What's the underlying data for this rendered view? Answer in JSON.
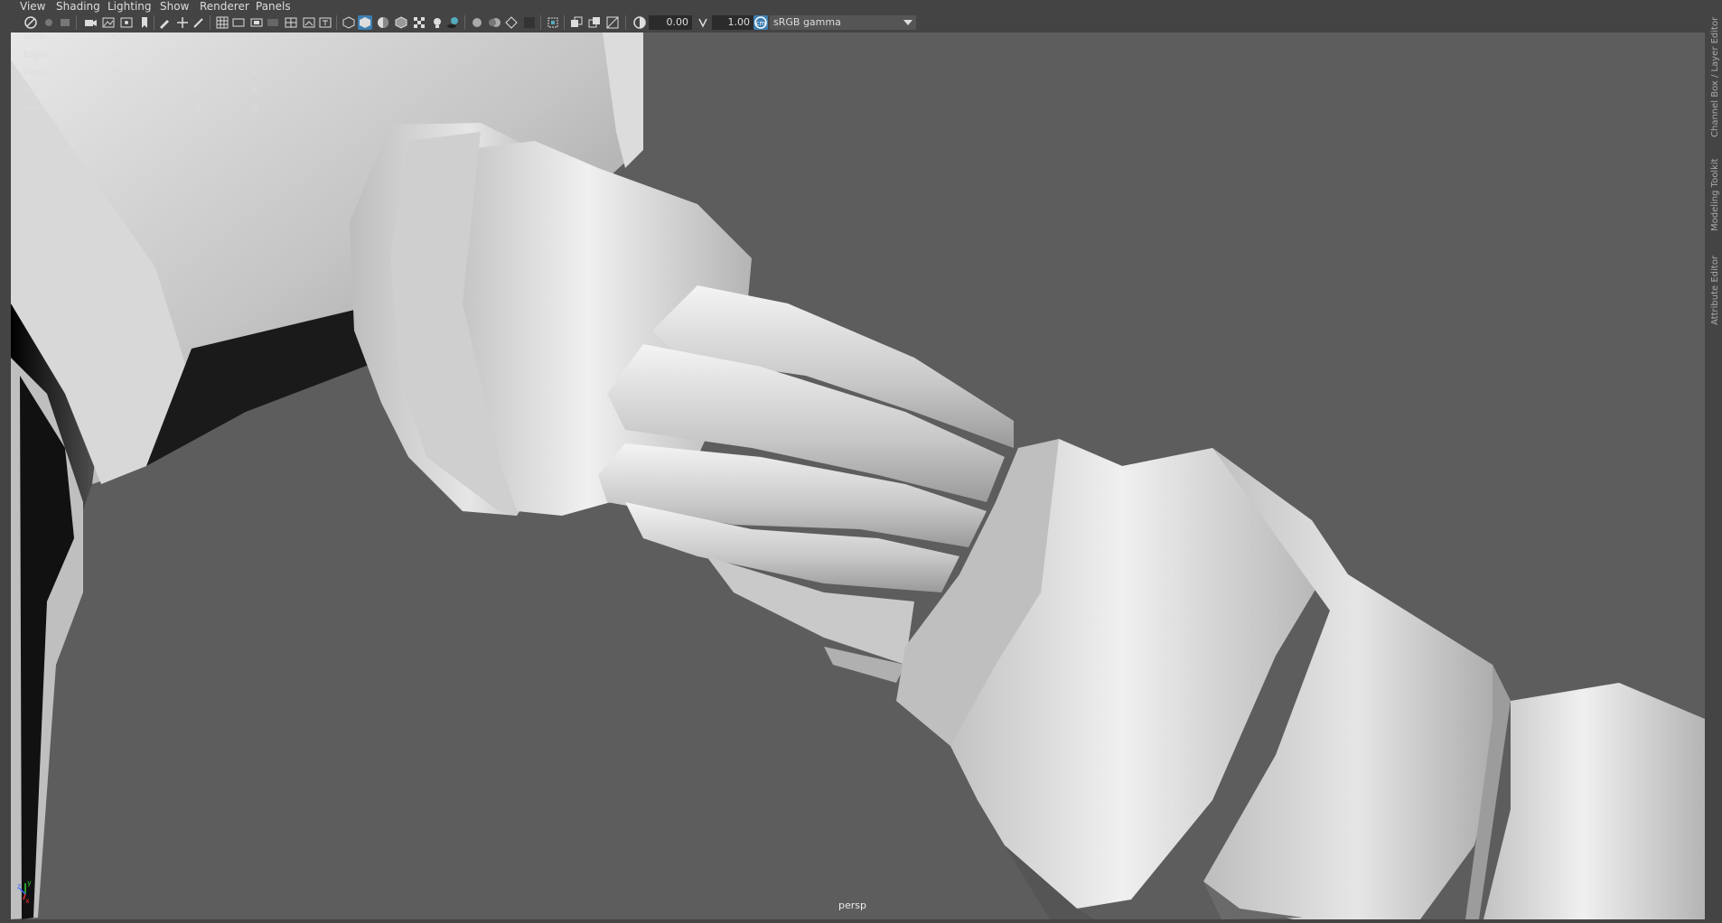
{
  "menu": [
    "View",
    "Shading",
    "Lighting",
    "Show",
    "Renderer",
    "Panels"
  ],
  "toolbar": {
    "field1": "0.00",
    "field2": "1.00",
    "color_space": "sRGB gamma"
  },
  "hud": {
    "rows": [
      {
        "label": "Verts:",
        "v1": "4023",
        "v2": "0",
        "v3": "0"
      },
      {
        "label": "Edges:",
        "v1": "11333",
        "v2": "0",
        "v3": "0"
      },
      {
        "label": "Faces:",
        "v1": "7331",
        "v2": "0",
        "v3": "0"
      },
      {
        "label": "Tris:",
        "v1": "7331",
        "v2": "0",
        "v3": "0"
      },
      {
        "label": "UVs:",
        "v1": "6930",
        "v2": "0",
        "v3": "0"
      }
    ]
  },
  "viewport": {
    "camera": "persp",
    "axis_labels": {
      "x": "x",
      "y": "y",
      "z": "z"
    }
  },
  "side_tabs": [
    "Channel Box / Layer Editor",
    "Modeling Toolkit",
    "Attribute Editor"
  ]
}
